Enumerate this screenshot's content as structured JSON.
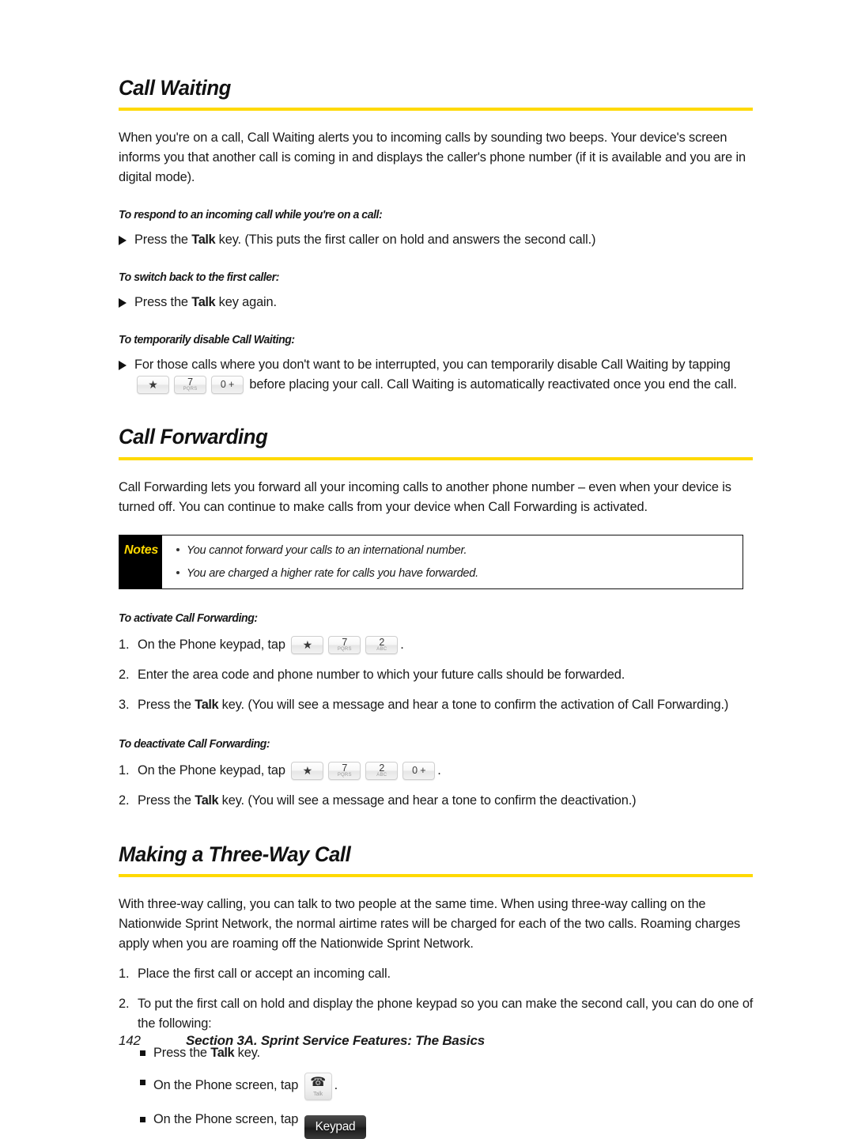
{
  "page": {
    "number": "142",
    "section_footer": "Section 3A. Sprint Service Features: The Basics",
    "accent_color": "#FFD900",
    "background_color": "#FFFFFF"
  },
  "sections": [
    {
      "id": "call-waiting",
      "heading": "Call Waiting",
      "intro": "When you're on a call, Call Waiting alerts you to incoming calls by sounding two beeps. Your device's screen informs you that another call is coming in and displays the caller's phone number (if it is available and you are in digital mode).",
      "sub1_heading": "To respond to an incoming call while you're on a call:",
      "sub1_bullet_a": "Press the ",
      "sub1_bullet_talk": "Talk",
      "sub1_bullet_b": " key. (This puts the first caller on hold and answers the second call.)",
      "sub2_heading": "To switch back to the first caller:",
      "sub2_bullet_a": "Press the ",
      "sub2_bullet_talk": "Talk",
      "sub2_bullet_b": " key again.",
      "sub3_heading": "To temporarily disable Call Waiting:",
      "sub3_text_a": "For those calls where you don't want to be interrupted, you can temporarily disable Call Waiting by tapping",
      "sub3_text_b": "before placing your call. Call Waiting is automatically reactivated once you end the call."
    },
    {
      "id": "call-forwarding",
      "heading": "Call Forwarding",
      "intro": "Call Forwarding lets you forward all your incoming calls to another phone number – even when your device is turned off. You can continue to make calls from your device when Call Forwarding is activated.",
      "notes_label": "Notes",
      "notes": [
        "You cannot forward your calls to an international number.",
        "You are charged a higher rate for calls you have forwarded."
      ],
      "activate_heading": "To activate Call Forwarding:",
      "activate_steps": {
        "step1_num": "1.",
        "step1_text": "On the Phone keypad, tap",
        "step1_trailing": ".",
        "step2_num": "2.",
        "step2_text": "Enter the area code and phone number to which your future calls should be forwarded.",
        "step3_num": "3.",
        "step3_text_a": "Press the ",
        "step3_talk": "Talk",
        "step3_text_b": " key. (You will see a message and hear a tone to confirm the activation of Call Forwarding.)"
      },
      "deactivate_heading": "To deactivate Call Forwarding:",
      "deactivate_steps": {
        "step1_num": "1.",
        "step1_text": "On the Phone keypad, tap",
        "step1_trailing": ".",
        "step2_num": "2.",
        "step2_text_a": "Press the ",
        "step2_talk": "Talk",
        "step2_text_b": " key. (You will see a message and hear a tone to confirm the deactivation.)"
      }
    },
    {
      "id": "three-way-call",
      "heading": "Making a Three-Way Call",
      "intro": "With three-way calling, you can talk to two people at the same time. When using three-way calling on the Nationwide Sprint Network, the normal airtime rates will be charged for each of the two calls. Roaming charges apply when you are roaming off the Nationwide Sprint Network.",
      "steps": {
        "step1_num": "1.",
        "step1_text": "Place the first call or accept an incoming call.",
        "step2_num": "2.",
        "step2_text": "To put the first call on hold and display the phone keypad so you can make the second call, you can do one of the following:"
      },
      "sub_bullets": {
        "b1_a": "Press the ",
        "b1_talk": "Talk",
        "b1_b": " key.",
        "b2_text": "On the Phone screen, tap",
        "b2_trailing": ".",
        "b3_text": "On the Phone screen, tap"
      }
    }
  ],
  "keys": {
    "star": {
      "main": "★",
      "sub": ""
    },
    "seven": {
      "main": "7",
      "sub": "PQRS"
    },
    "two": {
      "main": "2",
      "sub": "ABC"
    },
    "zero": {
      "main": "0 +",
      "sub": ""
    },
    "talk_button": {
      "glyph": "☎",
      "label": "Talk"
    },
    "keypad_button": {
      "label": "Keypad"
    }
  }
}
